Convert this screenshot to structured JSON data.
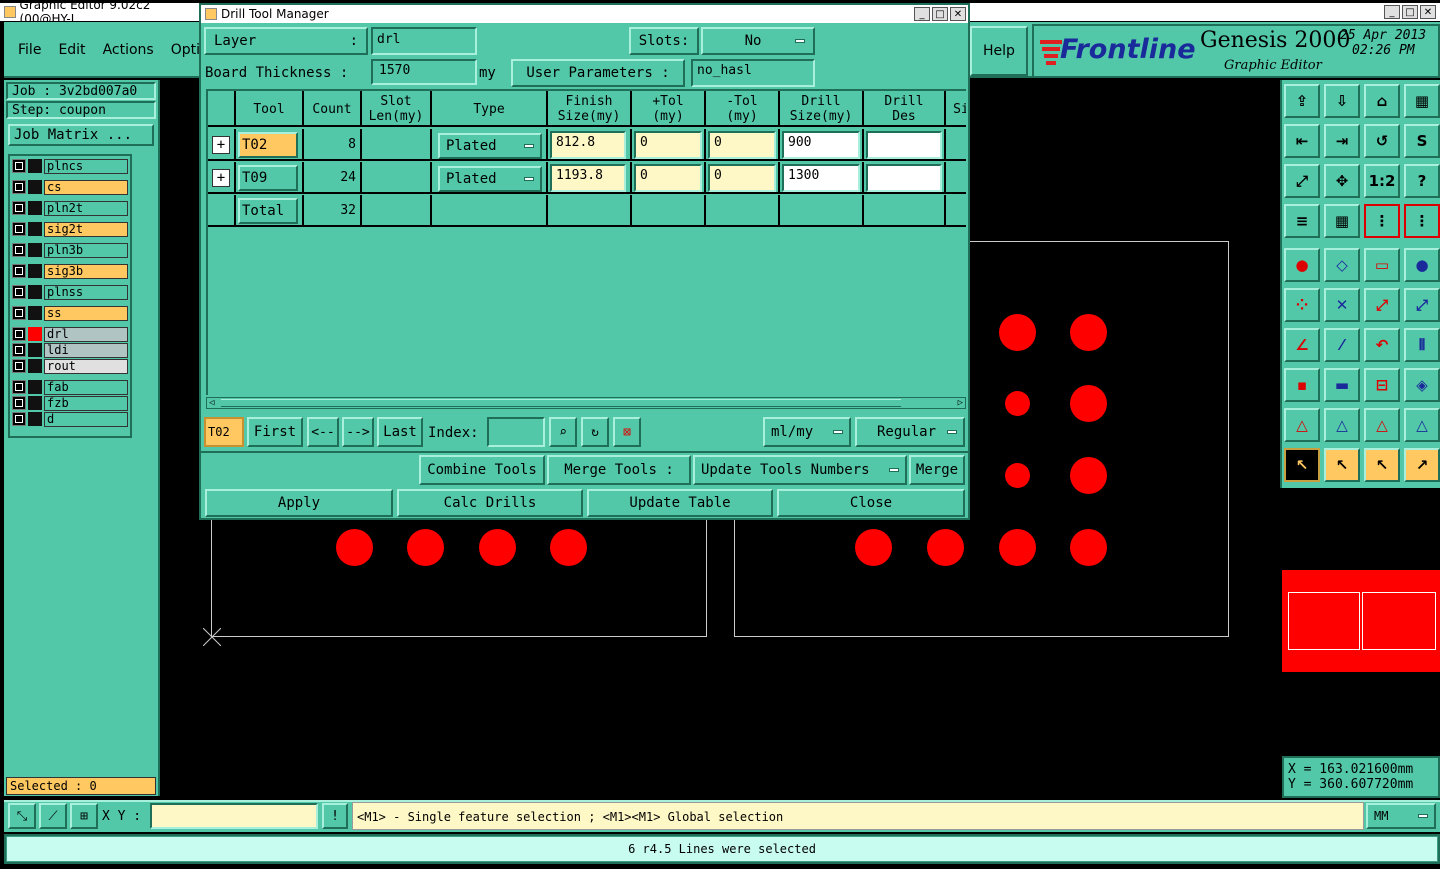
{
  "main_window": {
    "title": "Graphic Editor 9.02c2 (00@HY-I",
    "menu": [
      "File",
      "Edit",
      "Actions",
      "Optic"
    ],
    "help": "Help",
    "brand": "Frontline",
    "product": "Genesis 2000",
    "subtitle": "Graphic Editor",
    "date": "25 Apr 2013",
    "time": "02:26 PM"
  },
  "left_panel": {
    "job": "Job : 3v2bd007a0",
    "step": "Step: coupon",
    "job_matrix": "Job Matrix ...",
    "layers": [
      {
        "name": "plncs",
        "color": "#52c8a8"
      },
      {
        "name": "cs",
        "color": "#ffc860"
      },
      {
        "name": "pln2t",
        "color": "#52c8a8"
      },
      {
        "name": "sig2t",
        "color": "#ffc860"
      },
      {
        "name": "pln3b",
        "color": "#52c8a8"
      },
      {
        "name": "sig3b",
        "color": "#ffc860"
      },
      {
        "name": "plnss",
        "color": "#52c8a8"
      },
      {
        "name": "ss",
        "color": "#ffc860"
      },
      {
        "name": "drl",
        "color": "#b0c4c4"
      },
      {
        "name": "ldi",
        "color": "#b0c4c4"
      },
      {
        "name": "rout",
        "color": "#e0e0e0"
      },
      {
        "name": "fab",
        "color": "#52c8a8"
      },
      {
        "name": "fzb",
        "color": "#52c8a8"
      },
      {
        "name": "d",
        "color": "#52c8a8"
      }
    ],
    "selected": "Selected : 0"
  },
  "dialog": {
    "title": "Drill Tool Manager",
    "layer_label": "Layer",
    "layer_colon": ":",
    "layer_value": "drl",
    "slots_label": "Slots:",
    "slots_value": "No",
    "board_thickness_label": "Board Thickness :",
    "board_thickness_value": "1570",
    "board_thickness_unit": "my",
    "user_params_label": "User Parameters :",
    "user_params_value": "no_hasl",
    "headers": [
      "Tool",
      "Count",
      "Slot\nLen(my)",
      "Type",
      "Finish\nSize(my)",
      "+Tol\n(my)",
      "-Tol\n(my)",
      "Drill\nSize(my)",
      "Drill\nDes",
      "Si"
    ],
    "rows": [
      {
        "tool": "T02",
        "count": "8",
        "type": "Plated",
        "finish": "812.8",
        "ptol": "0",
        "mtol": "0",
        "drill": "900",
        "des": ""
      },
      {
        "tool": "T09",
        "count": "24",
        "type": "Plated",
        "finish": "1193.8",
        "ptol": "0",
        "mtol": "0",
        "drill": "1300",
        "des": ""
      }
    ],
    "total_label": "Total",
    "total_count": "32",
    "current_tool": "T02",
    "first": "First",
    "prev": "<--",
    "next": "-->",
    "last": "Last",
    "index_label": "Index:",
    "units": "ml/my",
    "mode": "Regular",
    "combine_tools": "Combine Tools",
    "merge_tools": "Merge Tools :",
    "update_tools_numbers": "Update Tools Numbers",
    "merge": "Merge",
    "apply": "Apply",
    "calc_drills": "Calc Drills",
    "update_table": "Update Table",
    "close": "Close"
  },
  "status": {
    "xy_label": "X Y :",
    "hint": "<M1> - Single feature selection ; <M1><M1> Global selection",
    "units": "MM",
    "message": "6 r4.5 Lines were selected",
    "coord_x": "X = 163.021600mm",
    "coord_y": "Y = 360.607720mm"
  },
  "colors": {
    "teal": "#52c8a8",
    "red": "#ff0000",
    "orange": "#ffc860",
    "frontline_red": "#e02020",
    "frontline_blue": "#1a2a9a"
  }
}
